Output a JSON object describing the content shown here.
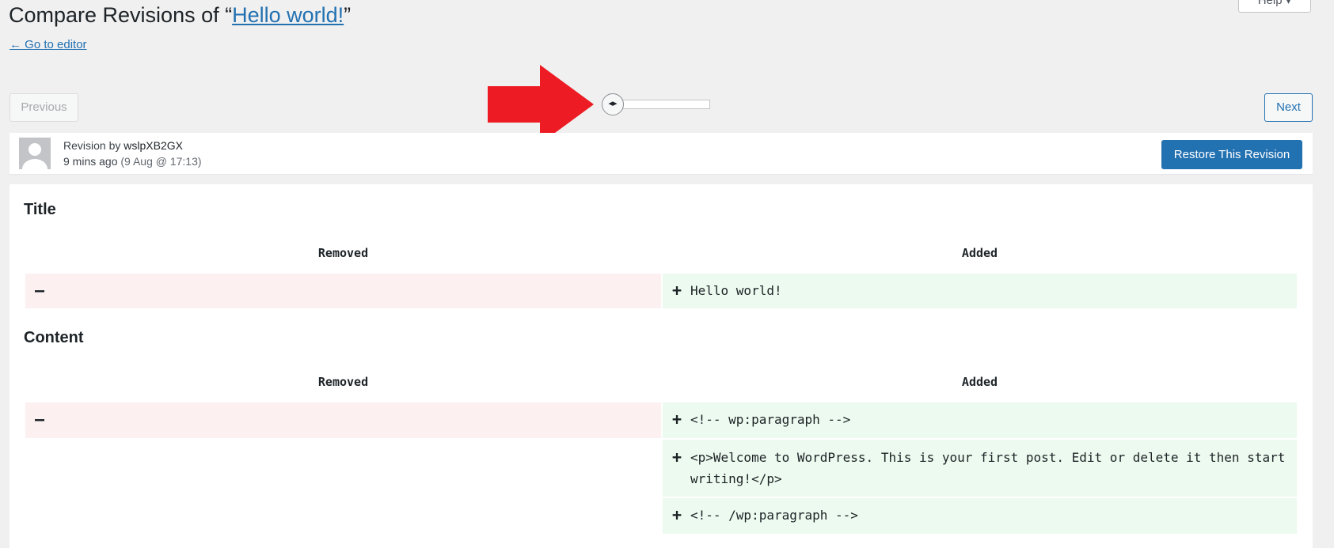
{
  "header": {
    "title_prefix": "Compare Revisions of “",
    "post_title": "Hello world!",
    "title_suffix": "”",
    "back_link": "← Go to editor",
    "help": "Help ▾"
  },
  "controls": {
    "previous": "Previous",
    "next": "Next",
    "slider_handle": "◂▸"
  },
  "revision_meta": {
    "revision_by": "Revision by ",
    "author": "wslpXB2GX",
    "time_ago": "9 mins ago",
    "date_detail": " (9 Aug @ 17:13)",
    "restore_button": "Restore This Revision"
  },
  "diff": {
    "title_section": {
      "heading": "Title",
      "removed_header": "Removed",
      "added_header": "Added",
      "removed_sign": "–",
      "added_sign": "+",
      "added_line": "Hello world!"
    },
    "content_section": {
      "heading": "Content",
      "removed_header": "Removed",
      "added_header": "Added",
      "removed_sign": "–",
      "added_lines": [
        {
          "sign": "+",
          "text": "<!-- wp:paragraph -->"
        },
        {
          "sign": "+",
          "text": "<p>Welcome to WordPress. This is your first post. Edit or delete it then start writing!</p>"
        },
        {
          "sign": "+",
          "text": "<!-- /wp:paragraph -->"
        }
      ]
    }
  },
  "colors": {
    "accent": "#2271b1",
    "removed_bg": "#fcf0f1",
    "added_bg": "#edfaef",
    "annotation_arrow": "#ed1c24"
  }
}
